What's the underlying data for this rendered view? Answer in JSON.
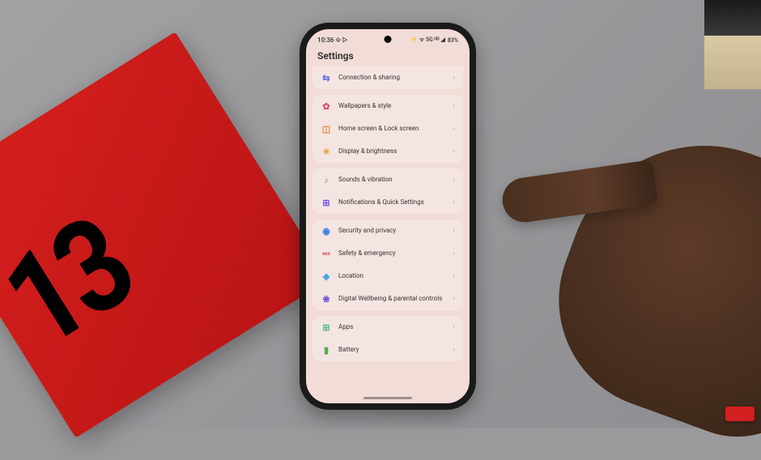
{
  "status_bar": {
    "time": "10:36",
    "extra_left": "⟐ ▷",
    "signal_indicators": "⚡ ᯤ 5G ᴴᴰ ◢",
    "battery_text": "83%"
  },
  "page": {
    "title": "Settings"
  },
  "groups": [
    {
      "cut_top": true,
      "items": [
        {
          "icon": "connection-icon",
          "icon_color": "#5b6fe0",
          "glyph": "⇆",
          "label": "Connection & sharing"
        }
      ]
    },
    {
      "items": [
        {
          "icon": "wallpaper-icon",
          "icon_color": "#d94f6a",
          "glyph": "✿",
          "label": "Wallpapers & style"
        },
        {
          "icon": "home-lock-icon",
          "icon_color": "#e08a3a",
          "glyph": "◫",
          "label": "Home screen & Lock screen"
        },
        {
          "icon": "display-icon",
          "icon_color": "#e0a030",
          "glyph": "☀",
          "label": "Display & brightness"
        }
      ]
    },
    {
      "items": [
        {
          "icon": "sounds-icon",
          "icon_color": "#4caf50",
          "glyph": "♪",
          "label": "Sounds & vibration"
        },
        {
          "icon": "notifications-icon",
          "icon_color": "#7b4fe0",
          "glyph": "⊞",
          "label": "Notifications & Quick Settings"
        }
      ]
    },
    {
      "items": [
        {
          "icon": "security-icon",
          "icon_color": "#3a7be0",
          "glyph": "◉",
          "label": "Security and privacy"
        },
        {
          "icon": "safety-icon",
          "icon_color": "#d94040",
          "glyph": "sos",
          "label": "Safety & emergency"
        },
        {
          "icon": "location-icon",
          "icon_color": "#3aa0e0",
          "glyph": "◈",
          "label": "Location"
        },
        {
          "icon": "wellbeing-icon",
          "icon_color": "#6a50d0",
          "glyph": "❀",
          "label": "Digital Wellbeing & parental controls"
        }
      ]
    },
    {
      "items": [
        {
          "icon": "apps-icon",
          "icon_color": "#50c080",
          "glyph": "⊞",
          "label": "Apps"
        },
        {
          "icon": "battery-icon",
          "icon_color": "#50b050",
          "glyph": "▮",
          "label": "Battery"
        }
      ]
    }
  ],
  "box_label": "13"
}
